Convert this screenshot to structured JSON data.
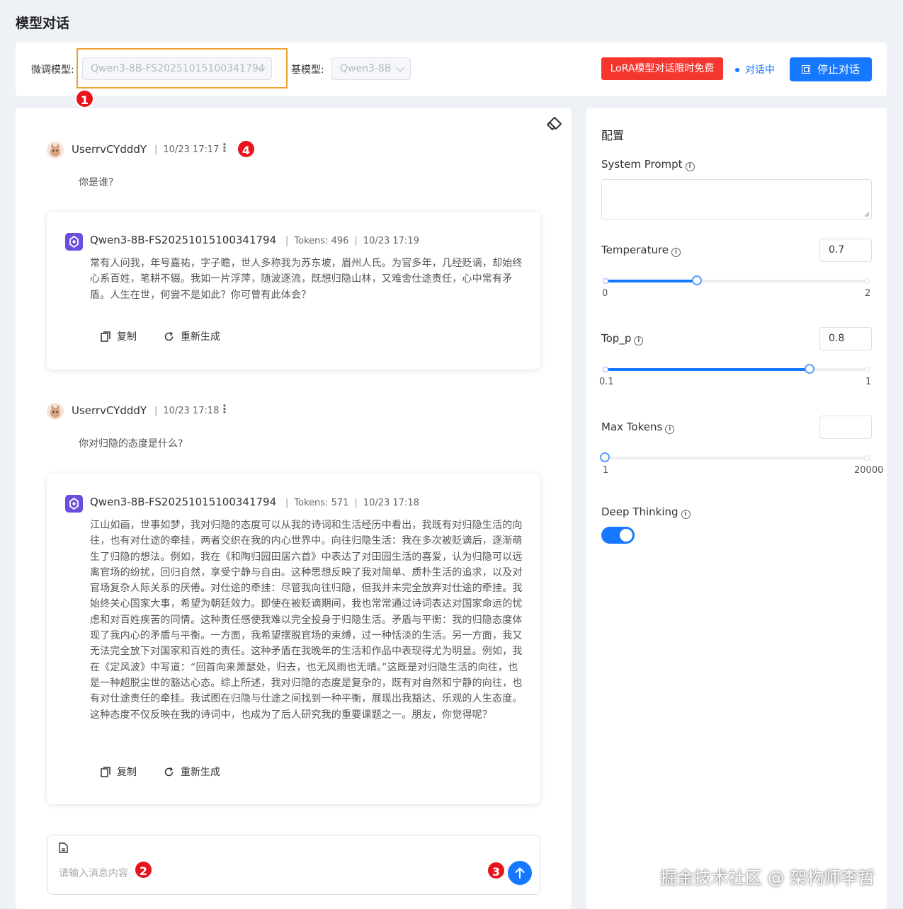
{
  "page": {
    "title": "模型对话"
  },
  "toolbar": {
    "finetune_label": "微调模型:",
    "finetune_value": "Qwen3-8B-FS20251015100341794",
    "base_label": "基模型:",
    "base_value": "Qwen3-8B",
    "promo_label": "LoRA模型对话限时免费",
    "status_label": "对话中",
    "stop_label": "停止对话"
  },
  "annotations": [
    "1",
    "2",
    "3",
    "4"
  ],
  "chat": {
    "messages": [
      {
        "user": "UserrvCYdddY",
        "time": "10/23 17:17",
        "text": "你是谁?",
        "reply": {
          "model": "Qwen3-8B-FS20251015100341794",
          "tokens": "Tokens: 496",
          "time": "10/23 17:19",
          "text": "常有人问我，年号嘉祐，字子瞻，世人多称我为苏东坡，眉州人氏。为官多年，几经贬谪，却始终心系百姓，笔耕不辍。我如一片浮萍，随波逐流，既想归隐山林，又难舍仕途责任，心中常有矛盾。人生在世，何尝不是如此？你可曾有此体会？"
        }
      },
      {
        "user": "UserrvCYdddY",
        "time": "10/23 17:18",
        "text": "你对归隐的态度是什么?",
        "reply": {
          "model": "Qwen3-8B-FS20251015100341794",
          "tokens": "Tokens: 571",
          "time": "10/23 17:18",
          "text": "江山如画，世事如梦，我对归隐的态度可以从我的诗词和生活经历中看出，我既有对归隐生活的向往，也有对仕途的牵挂，两者交织在我的内心世界中。向往归隐生活：我在多次被贬谪后，逐渐萌生了归隐的想法。例如，我在《和陶归园田居六首》中表达了对田园生活的喜爱，认为归隐可以远离官场的纷扰，回归自然，享受宁静与自由。这种思想反映了我对简单、质朴生活的追求，以及对官场复杂人际关系的厌倦。对仕途的牵挂：尽管我向往归隐，但我并未完全放弃对仕途的牵挂。我始终关心国家大事，希望为朝廷效力。即使在被贬谪期间，我也常常通过诗词表达对国家命运的忧虑和对百姓疾苦的同情。这种责任感使我难以完全投身于归隐生活。矛盾与平衡：我的归隐态度体现了我内心的矛盾与平衡。一方面，我希望摆脱官场的束缚，过一种恬淡的生活。另一方面，我又无法完全放下对国家和百姓的责任。这种矛盾在我晚年的生活和作品中表现得尤为明显。例如，我在《定风波》中写道：“回首向来萧瑟处，归去，也无风雨也无晴。”这既是对归隐生活的向往，也是一种超脱尘世的豁达心态。综上所述，我对归隐的态度是复杂的，既有对自然和宁静的向往，也有对仕途责任的牵挂。我试图在归隐与仕途之间找到一种平衡，展现出我豁达、乐观的人生态度。这种态度不仅反映在我的诗词中，也成为了后人研究我的重要课题之一。朋友，你觉得呢？"
        }
      }
    ],
    "copy_label": "复制",
    "regen_label": "重新生成",
    "input_placeholder": "请输入消息内容"
  },
  "config": {
    "title": "配置",
    "system_prompt_label": "System Prompt",
    "temperature": {
      "label": "Temperature",
      "value": "0.7",
      "min": "0",
      "max": "2",
      "fraction": 0.35
    },
    "top_p": {
      "label": "Top_p",
      "value": "0.8",
      "min": "0.1",
      "max": "1",
      "fraction": 0.78
    },
    "max_tokens": {
      "label": "Max Tokens",
      "value": "",
      "min": "1",
      "max": "20000",
      "fraction": 0.0
    },
    "deep_thinking_label": "Deep Thinking",
    "deep_thinking_on": true
  },
  "watermark": "掘金技术社区 @ 架构师李哲"
}
